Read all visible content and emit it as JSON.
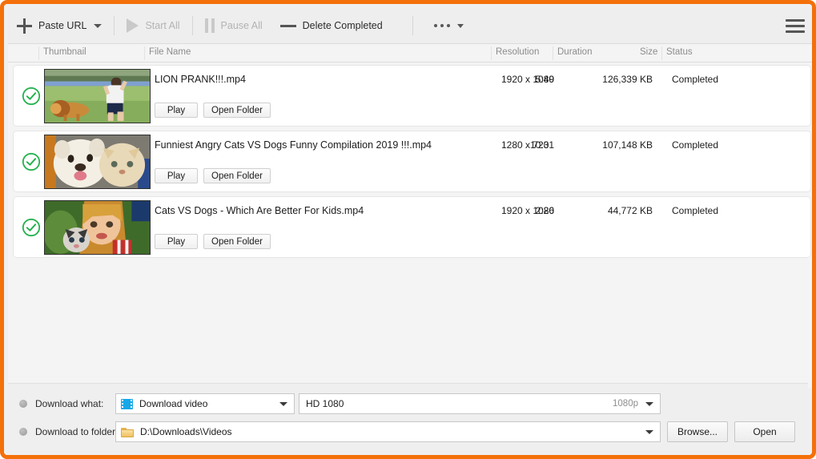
{
  "toolbar": {
    "paste_url": "Paste URL",
    "start_all": "Start All",
    "pause_all": "Pause All",
    "delete_completed": "Delete Completed",
    "more_icon": "more-dots-icon",
    "menu_icon": "hamburger-menu-icon"
  },
  "columns": {
    "thumbnail": "Thumbnail",
    "file_name": "File Name",
    "resolution": "Resolution",
    "duration": "Duration",
    "size": "Size",
    "status": "Status"
  },
  "row_actions": {
    "play": "Play",
    "open_folder": "Open Folder"
  },
  "downloads": [
    {
      "name": "LION PRANK!!!.mp4",
      "resolution": "1920 x 1080",
      "duration": "5:49",
      "size": "126,339 KB",
      "status": "Completed",
      "checked_icon": "green-check-circle-icon",
      "thumbnail_alt": "dog-in-lion-mane-chasing-man"
    },
    {
      "name": "Funniest Angry Cats VS Dogs Funny Compilation 2019 !!!.mp4",
      "resolution": "1280 x 720",
      "duration": "10:31",
      "size": "107,148 KB",
      "status": "Completed",
      "checked_icon": "green-check-circle-icon",
      "thumbnail_alt": "white-dog-and-ginger-cat"
    },
    {
      "name": "Cats VS Dogs - Which Are Better For Kids.mp4",
      "resolution": "1920 x 1080",
      "duration": "2:26",
      "size": "44,772 KB",
      "status": "Completed",
      "checked_icon": "green-check-circle-icon",
      "thumbnail_alt": "girl-holding-kitten"
    }
  ],
  "footer": {
    "download_what_label": "Download what:",
    "download_to_label": "Download to folder:",
    "media_type_value": "Download video",
    "media_type_icon": "film-strip-icon",
    "quality_value": "HD 1080",
    "quality_badge": "1080p",
    "folder_value": "D:\\Downloads\\Videos",
    "folder_icon": "folder-icon",
    "browse_button": "Browse...",
    "open_button": "Open"
  },
  "colors": {
    "accent": "#f4700a",
    "success": "#22b14c",
    "panel": "#efefef",
    "list_bg": "#f4f4f4"
  }
}
